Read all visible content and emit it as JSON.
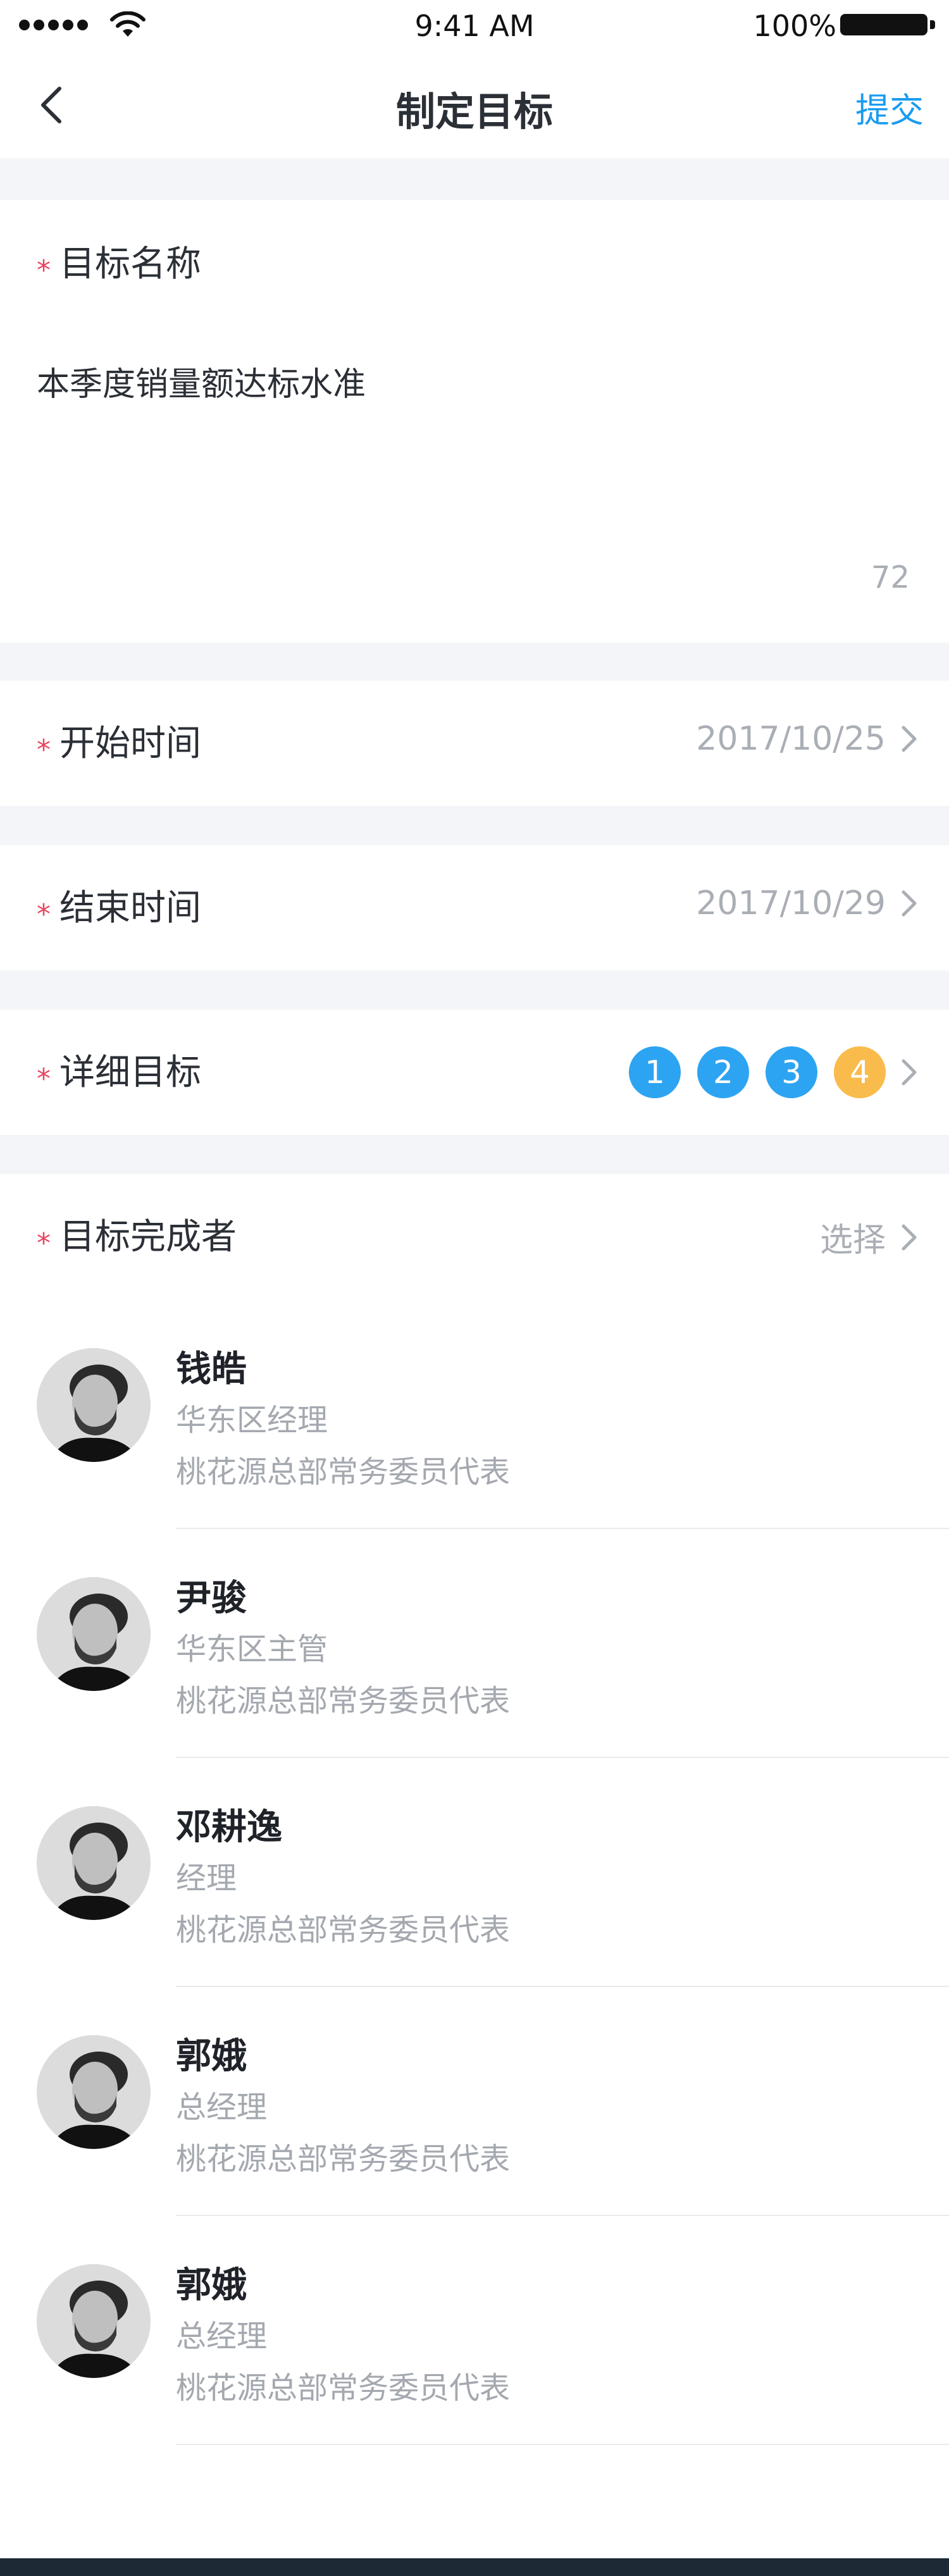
{
  "status_bar": {
    "time": "9:41 AM",
    "battery": "100%"
  },
  "nav": {
    "title": "制定目标",
    "action": "提交"
  },
  "goal_name": {
    "label": "目标名称",
    "value": "本季度销量额达标水准",
    "counter": "72"
  },
  "start_time": {
    "label": "开始时间",
    "value": "2017/10/25"
  },
  "end_time": {
    "label": "结束时间",
    "value": "2017/10/29"
  },
  "detail_goals": {
    "label": "详细目标",
    "badges": [
      "1",
      "2",
      "3",
      "4"
    ],
    "colors": {
      "blue": "#2da4f1",
      "orange": "#f9bb4b"
    }
  },
  "completers": {
    "label": "目标完成者",
    "action": "选择",
    "people": [
      {
        "name": "钱皓",
        "title": "华东区经理",
        "org": "桃花源总部常务委员代表"
      },
      {
        "name": "尹骏",
        "title": "华东区主管",
        "org": "桃花源总部常务委员代表"
      },
      {
        "name": "邓耕逸",
        "title": "经理",
        "org": "桃花源总部常务委员代表"
      },
      {
        "name": "郭娥",
        "title": "总经理",
        "org": "桃花源总部常务委员代表"
      },
      {
        "name": "郭娥",
        "title": "总经理",
        "org": "桃花源总部常务委员代表"
      }
    ]
  },
  "colors": {
    "accent": "#1a9cf0",
    "required_star": "#e8465f",
    "background": "#f4f5f8"
  }
}
